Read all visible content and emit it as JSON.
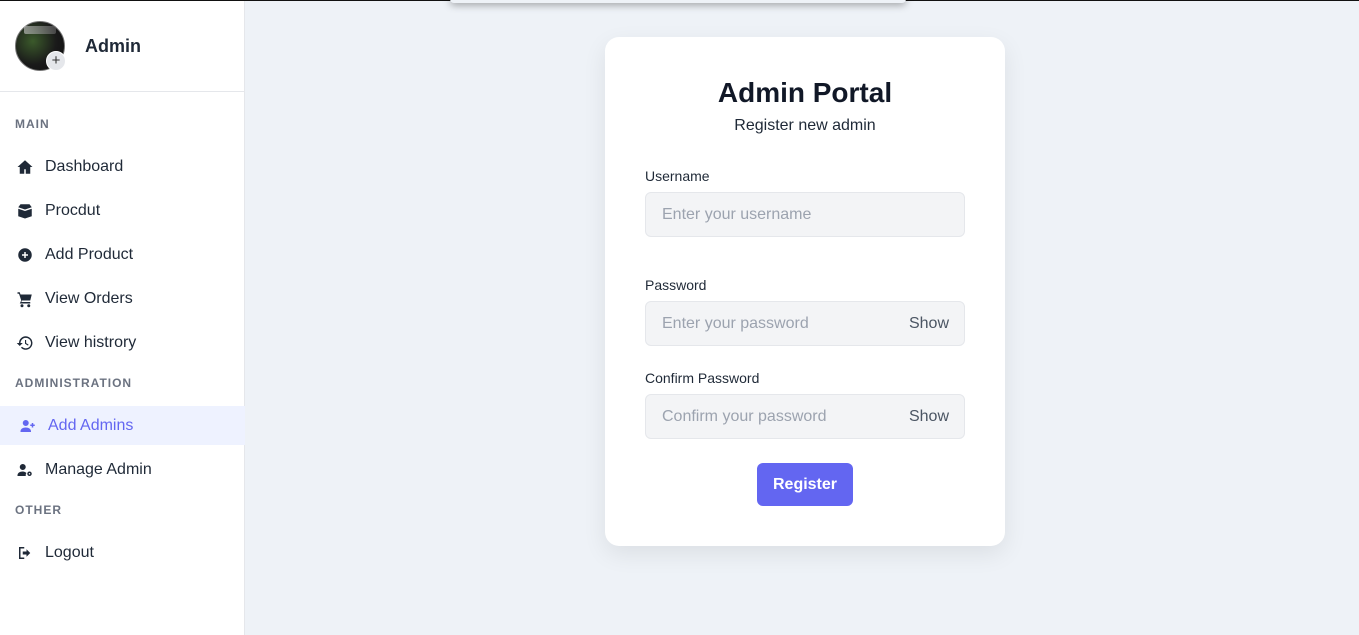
{
  "sidebar": {
    "brand_name": "Admin",
    "sections": {
      "main": "MAIN",
      "administration": "ADMINISTRATION",
      "other": "OTHER"
    },
    "items": [
      {
        "label": "Dashboard",
        "icon": "home-icon"
      },
      {
        "label": "Procdut",
        "icon": "box-icon"
      },
      {
        "label": "Add Product",
        "icon": "plus-circle-icon"
      },
      {
        "label": "View Orders",
        "icon": "cart-icon"
      },
      {
        "label": "View histrory",
        "icon": "history-icon"
      },
      {
        "label": "Add Admins",
        "icon": "user-plus-icon",
        "active": true
      },
      {
        "label": "Manage Admin",
        "icon": "user-gear-icon"
      },
      {
        "label": "Logout",
        "icon": "logout-icon"
      }
    ]
  },
  "form": {
    "title": "Admin Portal",
    "subtitle": "Register new admin",
    "username_label": "Username",
    "username_placeholder": "Enter your username",
    "password_label": "Password",
    "password_placeholder": "Enter your password",
    "confirm_label": "Confirm Password",
    "confirm_placeholder": "Confirm your password",
    "show_label": "Show",
    "register_label": "Register"
  },
  "colors": {
    "accent": "#6366f1",
    "active_bg": "#eef2ff",
    "page_bg": "#eef2f7"
  }
}
